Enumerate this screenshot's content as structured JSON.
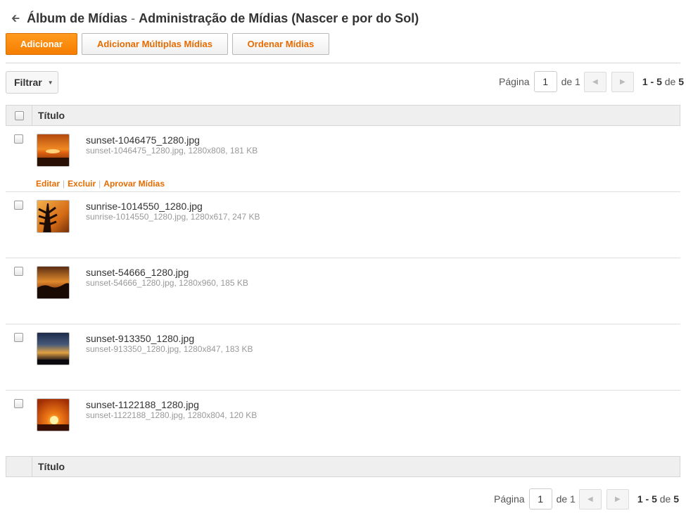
{
  "header": {
    "title": "Álbum de Mídias",
    "separator": "-",
    "subtitle": "Administração de Mídias (Nascer e por do Sol)"
  },
  "toolbar": {
    "add_label": "Adicionar",
    "add_multiple_label": "Adicionar Múltiplas Mídias",
    "order_label": "Ordenar Mídias"
  },
  "filter": {
    "label": "Filtrar"
  },
  "pager": {
    "page_label": "Página",
    "page_value": "1",
    "of_label": "de 1",
    "range": "1 - 5",
    "range_of": "de",
    "total": "5"
  },
  "table": {
    "header_title": "Título",
    "row_actions": {
      "edit": "Editar",
      "delete": "Excluir",
      "approve": "Aprovar Mídias"
    },
    "rows": [
      {
        "name": "sunset-1046475_1280.jpg",
        "meta": "sunset-1046475_1280.jpg, 1280x808, 181 KB"
      },
      {
        "name": "sunrise-1014550_1280.jpg",
        "meta": "sunrise-1014550_1280.jpg, 1280x617, 247 KB"
      },
      {
        "name": "sunset-54666_1280.jpg",
        "meta": "sunset-54666_1280.jpg, 1280x960, 185 KB"
      },
      {
        "name": "sunset-913350_1280.jpg",
        "meta": "sunset-913350_1280.jpg, 1280x847, 183 KB"
      },
      {
        "name": "sunset-1122188_1280.jpg",
        "meta": "sunset-1122188_1280.jpg, 1280x804, 120 KB"
      }
    ]
  },
  "colors": {
    "accent": "#e66b00",
    "primary_button": "#f57e00"
  },
  "icons": {
    "back": "back-arrow-icon",
    "caret": "caret-down-icon",
    "prev": "chevron-left-icon",
    "next": "chevron-right-icon"
  }
}
